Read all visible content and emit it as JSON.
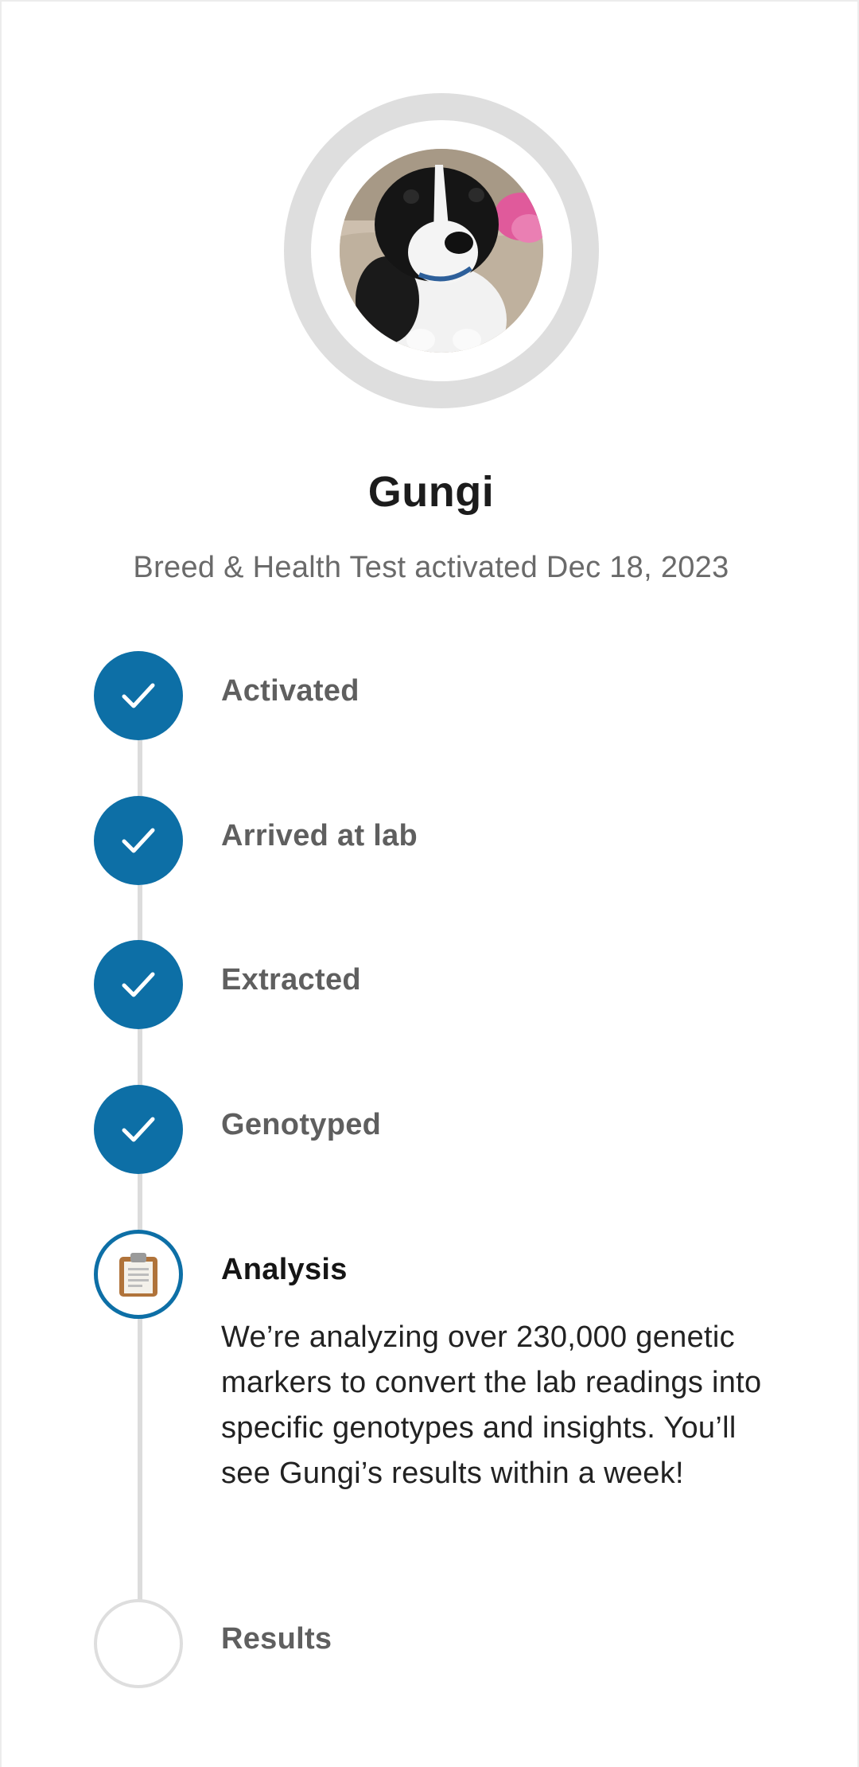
{
  "profile": {
    "name": "Gungi",
    "subtitle": "Breed & Health Test activated Dec 18, 2023"
  },
  "steps": [
    {
      "label": "Activated",
      "status": "done",
      "icon": "check-icon"
    },
    {
      "label": "Arrived at lab",
      "status": "done",
      "icon": "check-icon"
    },
    {
      "label": "Extracted",
      "status": "done",
      "icon": "check-icon"
    },
    {
      "label": "Genotyped",
      "status": "done",
      "icon": "check-icon"
    },
    {
      "label": "Analysis",
      "status": "current",
      "icon": "clipboard-icon",
      "description": "We’re analyzing over 230,000 genetic markers to convert the lab readings into specific genotypes and insights. You’ll see Gungi’s results within a week!"
    },
    {
      "label": "Results",
      "status": "pending",
      "icon": ""
    }
  ],
  "colors": {
    "accent": "#0d6fa6",
    "line": "#dcdcdc",
    "ring": "#dedede"
  }
}
